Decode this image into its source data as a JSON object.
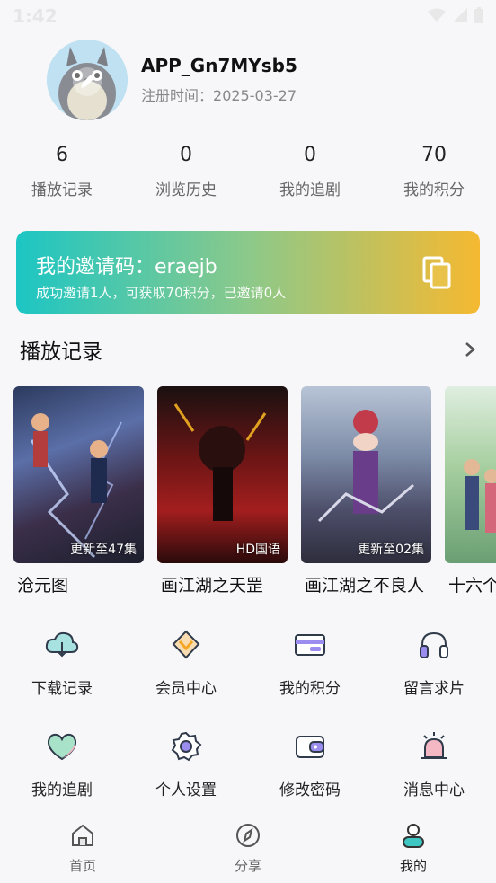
{
  "status_bar": {
    "time": "1:42"
  },
  "profile": {
    "username": "APP_Gn7MYsb5",
    "reg_label": "注册时间：",
    "reg_date": "2025-03-27"
  },
  "stats": [
    {
      "value": "6",
      "label": "播放记录"
    },
    {
      "value": "0",
      "label": "浏览历史"
    },
    {
      "value": "0",
      "label": "我的追剧"
    },
    {
      "value": "70",
      "label": "我的积分"
    }
  ],
  "invite": {
    "label": "我的邀请码：",
    "code": "eraejb",
    "description": "成功邀请1人，可获取70积分，已邀请0人"
  },
  "history": {
    "title": "播放记录",
    "items": [
      {
        "title": "沧元图",
        "badge": "更新至47集"
      },
      {
        "title": "画江湖之天罡",
        "badge": "HD国语"
      },
      {
        "title": "画江湖之不良人",
        "badge": "更新至02集"
      },
      {
        "title": "十六个",
        "badge": ""
      }
    ]
  },
  "menu": [
    {
      "label": "下载记录",
      "icon": "cloud-download-icon"
    },
    {
      "label": "会员中心",
      "icon": "vip-icon"
    },
    {
      "label": "我的积分",
      "icon": "card-icon"
    },
    {
      "label": "留言求片",
      "icon": "headphones-icon"
    },
    {
      "label": "我的追剧",
      "icon": "heart-icon"
    },
    {
      "label": "个人设置",
      "icon": "gear-icon"
    },
    {
      "label": "修改密码",
      "icon": "wallet-icon"
    },
    {
      "label": "消息中心",
      "icon": "alarm-icon"
    }
  ],
  "tabs": [
    {
      "label": "首页",
      "icon": "home-icon"
    },
    {
      "label": "分享",
      "icon": "compass-icon"
    },
    {
      "label": "我的",
      "icon": "user-icon",
      "active": true
    }
  ],
  "colors": {
    "invite_gradient": [
      "#1cc6c4",
      "#8cc98a",
      "#f5b931"
    ],
    "icon_accent_teal": "#3ec6c3",
    "icon_accent_orange": "#f5a623",
    "icon_accent_purple": "#9b8cf0"
  }
}
